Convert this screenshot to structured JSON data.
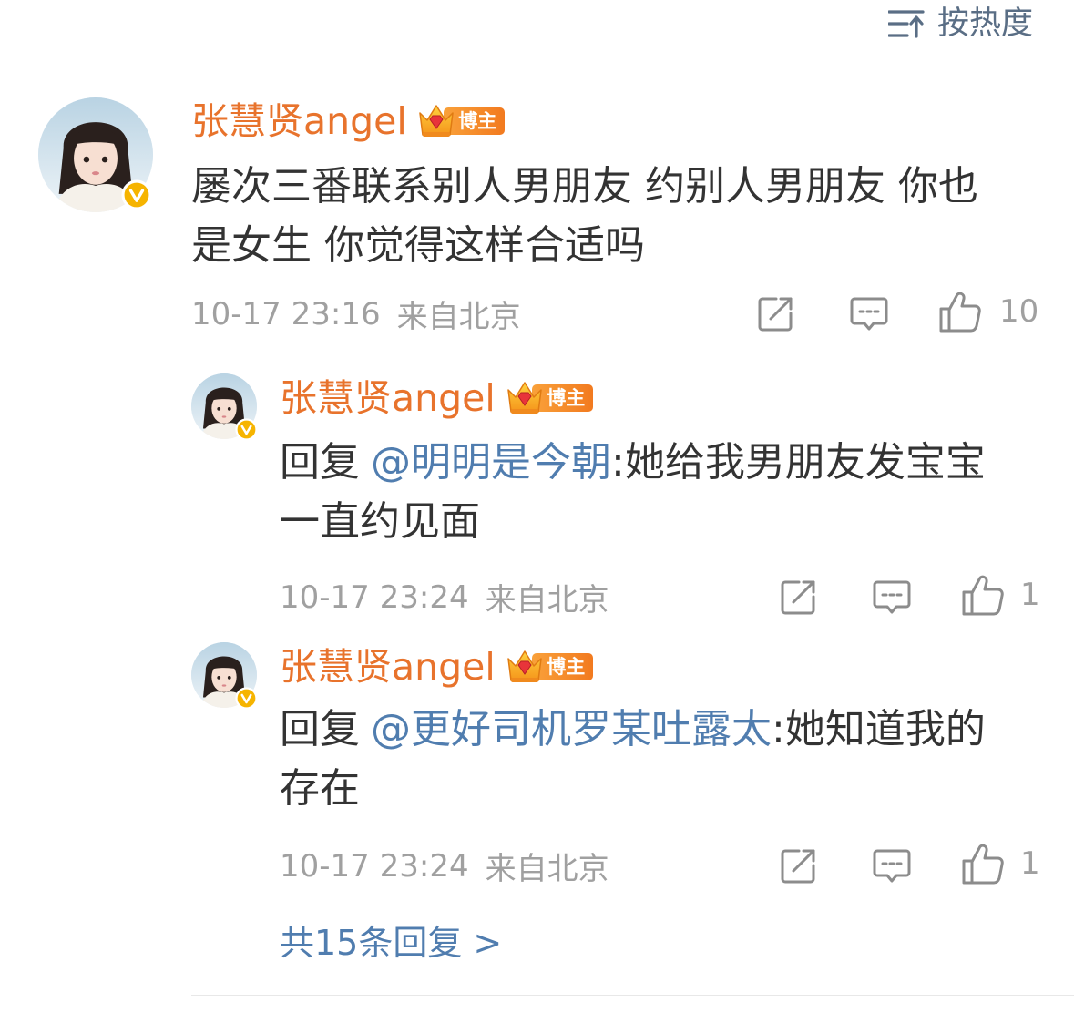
{
  "sort": {
    "icon": "sort-icon",
    "label": "按热度"
  },
  "comment": {
    "user": {
      "name": "张慧贤angel",
      "badge": "博主",
      "verified": true,
      "avatar": "avatar"
    },
    "text": "屡次三番联系别人男朋友 约别人男朋友 你也是女生 你觉得这样合适吗",
    "time": "10-17 23:16",
    "location": "来自北京",
    "likes": "10"
  },
  "replies": [
    {
      "user": {
        "name": "张慧贤angel",
        "badge": "博主",
        "verified": true,
        "avatar": "avatar"
      },
      "prefix": "回复",
      "mention": "@明明是今朝",
      "text": ":她给我男朋友发宝宝一直约见面",
      "time": "10-17 23:24",
      "location": "来自北京",
      "likes": "1"
    },
    {
      "user": {
        "name": "张慧贤angel",
        "badge": "博主",
        "verified": true,
        "avatar": "avatar"
      },
      "prefix": "回复",
      "mention": "@更好司机罗某吐露太",
      "text": ":她知道我的存在",
      "time": "10-17 23:24",
      "location": "来自北京",
      "likes": "1"
    }
  ],
  "more_replies": "共15条回复 >",
  "icons": {
    "sort": "sort-icon",
    "repost": "repost-icon",
    "comment": "comment-icon",
    "like": "like-icon",
    "verified": "verified-icon",
    "crown": "crown-icon"
  },
  "colors": {
    "name": "#e8732c",
    "link": "#507daf",
    "text": "#333333",
    "meta": "#a0a0a0",
    "sort": "#5a6e85",
    "icon": "#8c8c8c",
    "badge1": "#f9a13a",
    "badge2": "#f27a1f",
    "verified": "#f6b400"
  }
}
